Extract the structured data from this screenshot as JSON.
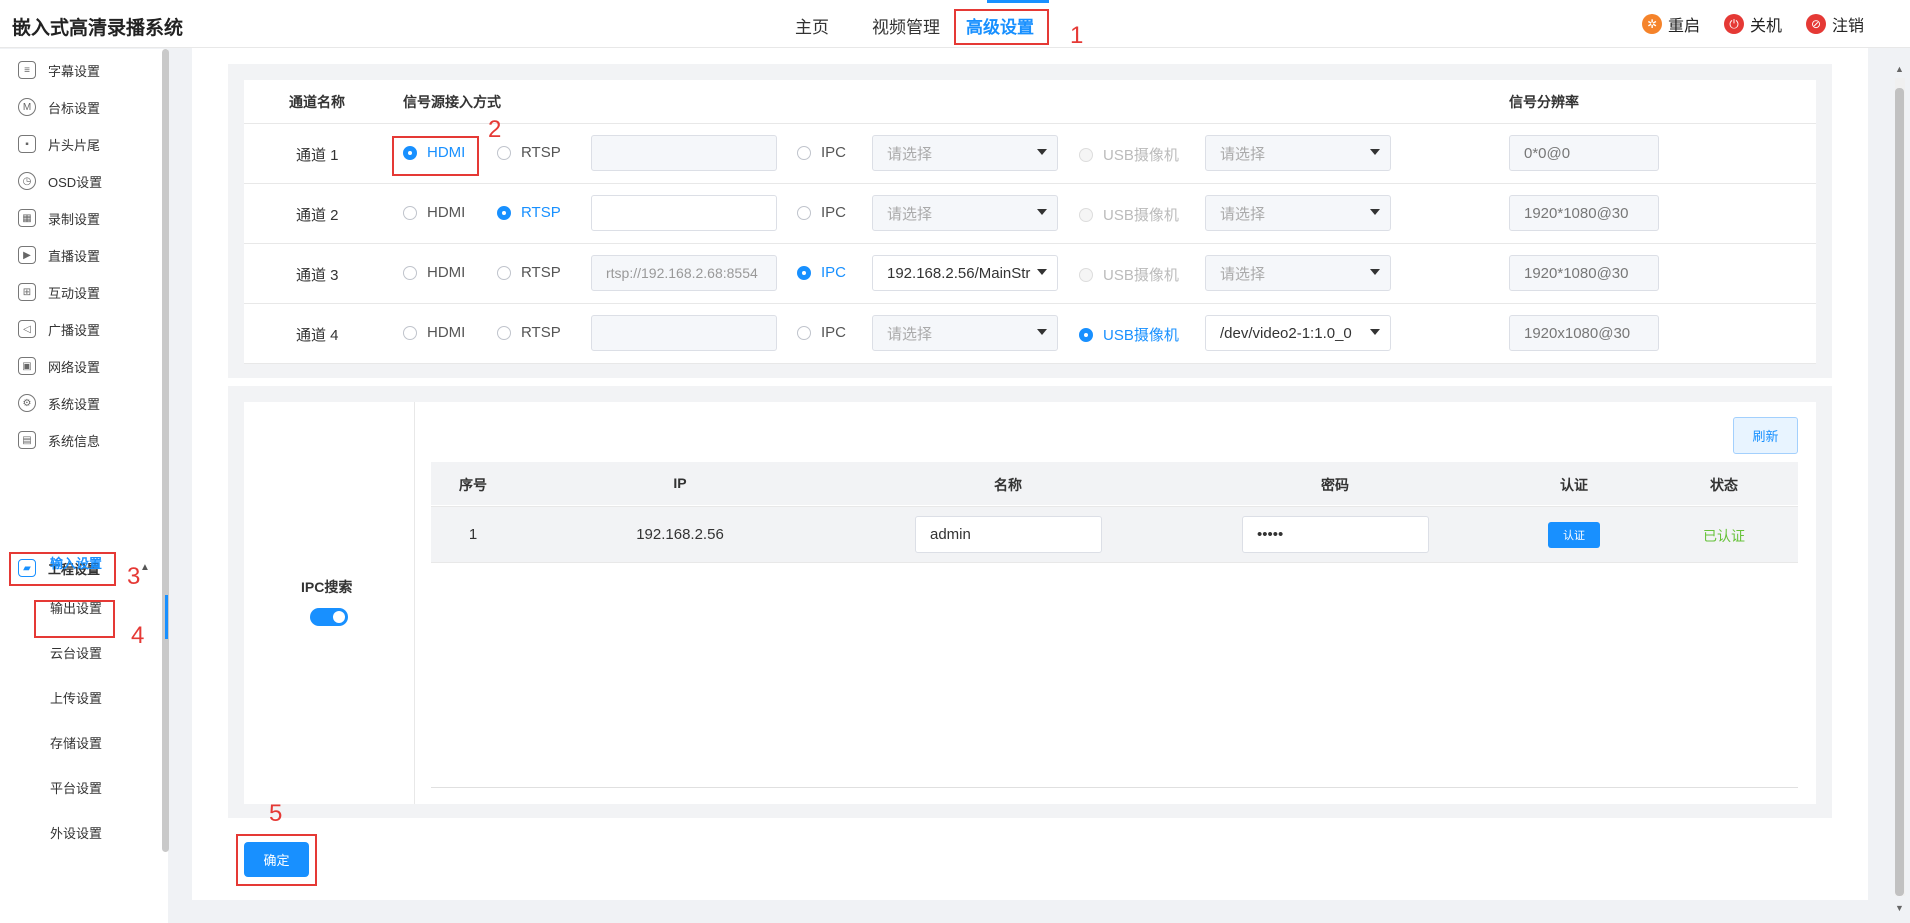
{
  "header": {
    "app_title": "嵌入式高清录播系统",
    "nav": [
      "主页",
      "视频管理",
      "高级设置"
    ],
    "actions": [
      {
        "label": "重启",
        "icon": "reboot-icon",
        "color": "#f5832a",
        "glyph": "✲"
      },
      {
        "label": "关机",
        "icon": "power-icon",
        "color": "#e53935",
        "glyph": "⏻"
      },
      {
        "label": "注销",
        "icon": "logout-icon",
        "color": "#e53935",
        "glyph": "⊘"
      }
    ]
  },
  "sidebar": {
    "items": [
      {
        "label": "字幕设置",
        "icon": "subtitle-icon",
        "glyph": "≡"
      },
      {
        "label": "台标设置",
        "icon": "logo-mark-icon",
        "glyph": "M"
      },
      {
        "label": "片头片尾",
        "icon": "clip-icon",
        "glyph": "▪"
      },
      {
        "label": "OSD设置",
        "icon": "clock-icon",
        "glyph": "◷"
      },
      {
        "label": "录制设置",
        "icon": "film-icon",
        "glyph": "▦"
      },
      {
        "label": "直播设置",
        "icon": "live-icon",
        "glyph": "▶"
      },
      {
        "label": "互动设置",
        "icon": "interaction-icon",
        "glyph": "⊞"
      },
      {
        "label": "广播设置",
        "icon": "broadcast-icon",
        "glyph": "◁"
      },
      {
        "label": "网络设置",
        "icon": "network-icon",
        "glyph": "▣"
      },
      {
        "label": "系统设置",
        "icon": "gear-icon",
        "glyph": "⚙"
      },
      {
        "label": "系统信息",
        "icon": "info-doc-icon",
        "glyph": "▤"
      }
    ],
    "parent": {
      "label": "工程设置",
      "icon": "engineering-icon",
      "glyph": "▰"
    },
    "sub_items": [
      "输入设置",
      "输出设置",
      "云台设置",
      "上传设置",
      "存储设置",
      "平台设置",
      "外设设置"
    ]
  },
  "input_table": {
    "headers": {
      "channel": "通道名称",
      "source": "信号源接入方式",
      "resolution": "信号分辨率"
    },
    "option_labels": {
      "hdmi": "HDMI",
      "rtsp": "RTSP",
      "ipc": "IPC",
      "usb": "USB摄像机"
    },
    "rows": [
      {
        "name": "通道 1",
        "selected": "hdmi",
        "rtsp_value": "",
        "ipc_value": "请选择",
        "usb_value": "请选择",
        "resolution": "0*0@0"
      },
      {
        "name": "通道 2",
        "selected": "rtsp",
        "rtsp_value": "",
        "ipc_value": "请选择",
        "usb_value": "请选择",
        "resolution": "1920*1080@30"
      },
      {
        "name": "通道 3",
        "selected": "ipc",
        "rtsp_value": "rtsp://192.168.2.68:8554",
        "ipc_value": "192.168.2.56/MainStr",
        "usb_value": "请选择",
        "resolution": "1920*1080@30"
      },
      {
        "name": "通道 4",
        "selected": "usb",
        "rtsp_value": "",
        "ipc_value": "请选择",
        "usb_value": "/dev/video2-1:1.0_0",
        "resolution": "1920x1080@30"
      }
    ]
  },
  "ipc_search": {
    "label": "IPC搜索",
    "enabled": true,
    "refresh_label": "刷新",
    "columns": [
      "序号",
      "IP",
      "名称",
      "密码",
      "认证",
      "状态"
    ],
    "rows": [
      {
        "index": "1",
        "ip": "192.168.2.56",
        "name": "admin",
        "password": "•••••",
        "auth_label": "认证",
        "status": "已认证"
      }
    ]
  },
  "confirm_label": "确定",
  "annotations": [
    "1",
    "2",
    "3",
    "4",
    "5"
  ]
}
